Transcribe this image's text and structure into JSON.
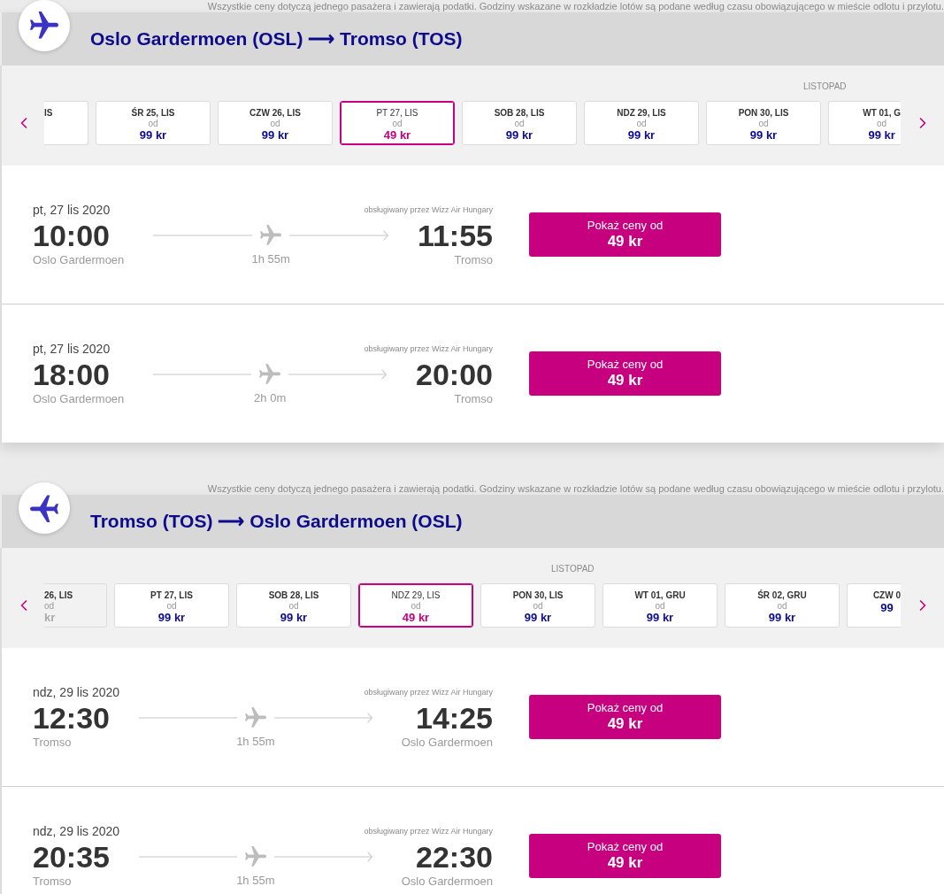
{
  "sections": [
    {
      "kind": "outbound",
      "note": "Wszystkie ceny dotyczą jednego pasażera i zawierają podatki. Godziny wskazane w rozkładzie lotów są podane według czasu obowiązującego w mieście odlotu i przylotu.",
      "title": "Oslo Gardermoen (OSL) ⟶ Tromso (TOS)",
      "month": "LISTOPAD",
      "dates": [
        {
          "kind": "cut_left",
          "label": "IS",
          "selected": false,
          "disabled": false
        },
        {
          "kind": "full",
          "label": "ŚR 25, LIS",
          "from": "od",
          "price": "99 kr",
          "selected": false,
          "disabled": false
        },
        {
          "kind": "full",
          "label": "CZW 26, LIS",
          "from": "od",
          "price": "99 kr",
          "selected": false,
          "disabled": false
        },
        {
          "kind": "full",
          "label": "PT 27, LIS",
          "from": "od",
          "price": "49 kr",
          "selected": true,
          "disabled": false
        },
        {
          "kind": "full",
          "label": "SOB 28, LIS",
          "from": "od",
          "price": "99 kr",
          "selected": false,
          "disabled": false
        },
        {
          "kind": "full",
          "label": "NDZ 29, LIS",
          "from": "od",
          "price": "99 kr",
          "selected": false,
          "disabled": false
        },
        {
          "kind": "full",
          "label": "PON 30, LIS",
          "from": "od",
          "price": "99 kr",
          "selected": false,
          "disabled": false
        },
        {
          "kind": "cut_right",
          "label": "WT 01, G",
          "from": "od",
          "price": "99 kr",
          "selected": false,
          "disabled": false
        }
      ],
      "flights": [
        {
          "date": "pt, 27 lis 2020",
          "operator": "obsługiwany przez Wizz Air Hungary",
          "departure_time": "10:00",
          "departure_airport": "Oslo Gardermoen",
          "duration": "1h 55m",
          "arrival_time": "11:55",
          "arrival_airport": "Tromso",
          "button": {
            "label": "Pokaż ceny od",
            "price": "49 kr"
          }
        },
        {
          "date": "pt, 27 lis 2020",
          "operator": "obsługiwany przez Wizz Air Hungary",
          "departure_time": "18:00",
          "departure_airport": "Oslo Gardermoen",
          "duration": "2h 0m",
          "arrival_time": "20:00",
          "arrival_airport": "Tromso",
          "button": {
            "label": "Pokaż ceny od",
            "price": "49 kr"
          }
        }
      ]
    },
    {
      "kind": "return",
      "note": "Wszystkie ceny dotyczą jednego pasażera i zawierają podatki. Godziny wskazane w rozkładzie lotów są podane według czasu obowiązującego w mieście odlotu i przylotu.",
      "title": "Tromso (TOS) ⟶ Oslo Gardermoen (OSL)",
      "month": "LISTOPAD",
      "dates": [
        {
          "kind": "cut_left",
          "label": "26, LIS",
          "from": "od",
          "price": "kr",
          "selected": false,
          "disabled": true
        },
        {
          "kind": "full",
          "label": "PT 27, LIS",
          "from": "od",
          "price": "99 kr",
          "selected": false,
          "disabled": false
        },
        {
          "kind": "full",
          "label": "SOB 28, LIS",
          "from": "od",
          "price": "99 kr",
          "selected": false,
          "disabled": false
        },
        {
          "kind": "full",
          "label": "NDZ 29, LIS",
          "from": "od",
          "price": "49 kr",
          "selected": true,
          "disabled": false
        },
        {
          "kind": "full",
          "label": "PON 30, LIS",
          "from": "od",
          "price": "99 kr",
          "selected": false,
          "disabled": false
        },
        {
          "kind": "full",
          "label": "WT 01, GRU",
          "from": "od",
          "price": "99 kr",
          "selected": false,
          "disabled": false
        },
        {
          "kind": "full",
          "label": "ŚR 02, GRU",
          "from": "od",
          "price": "99 kr",
          "selected": false,
          "disabled": false
        },
        {
          "kind": "cut_right",
          "label": "CZW 0",
          "price": "99",
          "selected": false,
          "disabled": false
        }
      ],
      "flights": [
        {
          "date": "ndz, 29 lis 2020",
          "operator": "obsługiwany przez Wizz Air Hungary",
          "departure_time": "12:30",
          "departure_airport": "Tromso",
          "duration": "1h 55m",
          "arrival_time": "14:25",
          "arrival_airport": "Oslo Gardermoen",
          "button": {
            "label": "Pokaż ceny od",
            "price": "49 kr"
          }
        },
        {
          "date": "ndz, 29 lis 2020",
          "operator": "obsługiwany przez Wizz Air Hungary",
          "departure_time": "20:35",
          "departure_airport": "Tromso",
          "duration": "1h 55m",
          "arrival_time": "22:30",
          "arrival_airport": "Oslo Gardermoen",
          "button": {
            "label": "Pokaż ceny od",
            "price": "49 kr"
          }
        }
      ]
    }
  ]
}
